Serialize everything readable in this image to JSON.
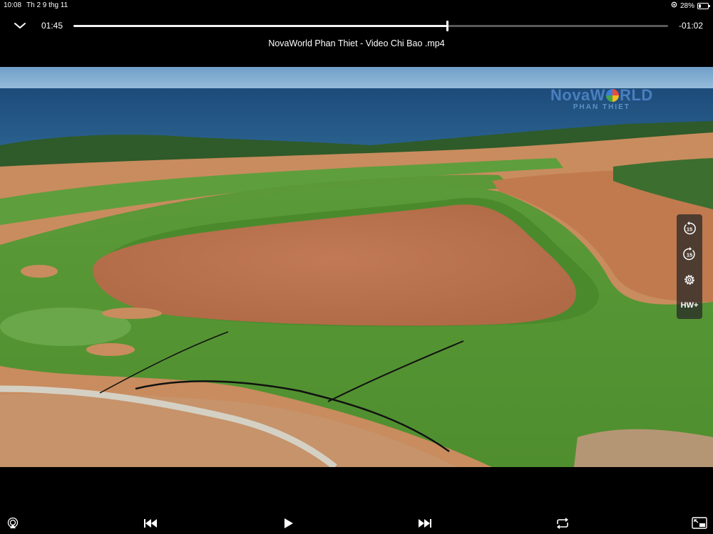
{
  "status_bar": {
    "time": "10:08",
    "date": "Th 2 9 thg 11",
    "battery_percent": "28%",
    "battery_level": 0.28
  },
  "player": {
    "elapsed": "01:45",
    "remaining": "-01:02",
    "progress_fraction": 0.628,
    "title": "NovaWorld Phan Thiet - Video Chi Bao .mp4"
  },
  "watermark": {
    "brand_part1": "Nova",
    "brand_part2": "W",
    "brand_part3": "RLD",
    "subtitle": "PHAN THIET"
  },
  "side_controls": {
    "skip_back_seconds": "15",
    "skip_forward_seconds": "15",
    "decoder_label": "HW+"
  },
  "icons": {
    "collapse": "chevron-down-icon",
    "skip_back": "rewind-15-icon",
    "skip_forward": "forward-15-icon",
    "settings": "gear-icon",
    "airplay": "airplay-icon",
    "previous": "previous-track-icon",
    "play": "play-icon",
    "next": "next-track-icon",
    "repeat": "repeat-icon",
    "pip": "picture-in-picture-icon"
  },
  "colors": {
    "background": "#000000",
    "text": "#ffffff",
    "scrub_track": "#5a5a5a",
    "scrub_fill": "#f2f2f2",
    "logo_blue": "#4a7fbf"
  }
}
